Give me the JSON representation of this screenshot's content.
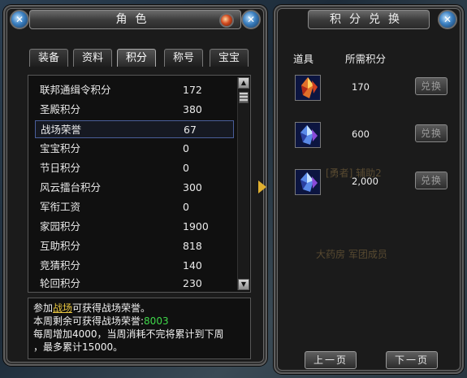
{
  "character_panel": {
    "title": "角色",
    "tabs": [
      {
        "label": "装备"
      },
      {
        "label": "资料"
      },
      {
        "label": "积分",
        "active": true
      },
      {
        "label": "称号"
      },
      {
        "label": "宝宝"
      }
    ],
    "points": [
      {
        "name": "联邦通缉令积分",
        "value": "172"
      },
      {
        "name": "圣殿积分",
        "value": "380"
      },
      {
        "name": "战场荣誉",
        "value": "67",
        "selected": true
      },
      {
        "name": "宝宝积分",
        "value": "0"
      },
      {
        "name": "节日积分",
        "value": "0"
      },
      {
        "name": "风云擂台积分",
        "value": "300"
      },
      {
        "name": "军衔工资",
        "value": "0"
      },
      {
        "name": "家园积分",
        "value": "1900"
      },
      {
        "name": "互助积分",
        "value": "818"
      },
      {
        "name": "竞猜积分",
        "value": "140"
      },
      {
        "name": "轮回积分",
        "value": "230"
      }
    ],
    "info": {
      "line1_prefix": "参加",
      "line1_link": "战场",
      "line1_suffix": "可获得战场荣誉。",
      "line2_prefix": "本周剩余可获得战场荣誉:",
      "line2_value": "8003",
      "line3": "每周增加4000，当周消耗不完将累计到下周",
      "line4": "，最多累计15000。"
    }
  },
  "exchange_panel": {
    "title": "积分兑换",
    "col_item": "道具",
    "col_points": "所需积分",
    "items": [
      {
        "price": "170",
        "icon": "red-crystal-icon",
        "button": "兑换"
      },
      {
        "price": "600",
        "icon": "blue-crystal-icon",
        "button": "兑换"
      },
      {
        "price": "2,000",
        "icon": "blue-crystal-icon",
        "button": "兑换"
      }
    ],
    "prev_label": "上一页",
    "next_label": "下一页"
  },
  "colors": {
    "highlight_link": "#e8c640",
    "remaining_value": "#3fd84a",
    "selection_border": "#4a5e9a"
  }
}
